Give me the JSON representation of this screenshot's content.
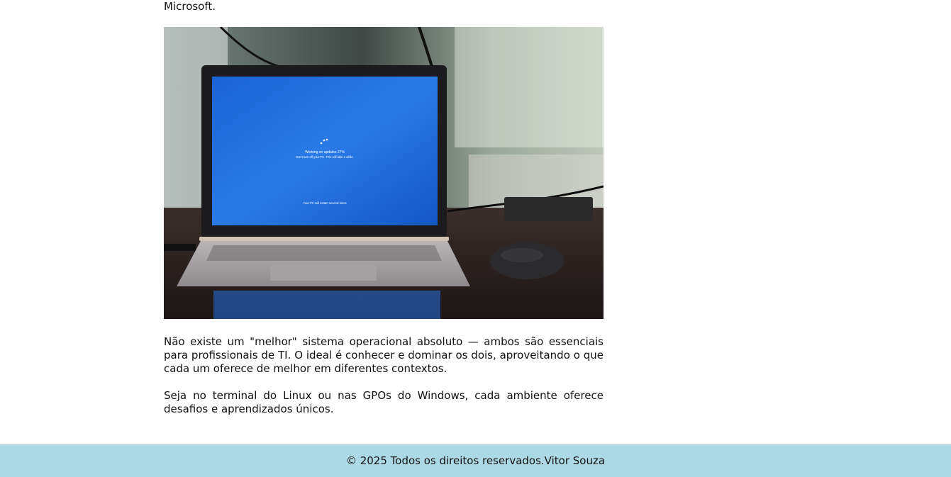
{
  "article": {
    "lead_fragment": "Microsoft.",
    "image": {
      "screen_texts": [
        "Working on updates  27%",
        "Don't turn off your PC. This will take a while.",
        "Your PC will restart several times"
      ]
    },
    "paragraphs": [
      "Não existe um \"melhor\" sistema operacional absoluto — ambos são essenciais para profissionais de TI. O ideal é conhecer e dominar os dois, aproveitando o que cada um oferece de melhor em diferentes contextos.",
      "Seja no terminal do Linux ou nas GPOs do Windows, cada ambiente oferece desafios e aprendizados únicos."
    ]
  },
  "footer": {
    "copyright": "© 2025 Todos os direitos reservados.",
    "author": "Vitor Souza"
  },
  "colors": {
    "footer_background": "#add8e6",
    "screen_blue": "#1f6fe0"
  }
}
